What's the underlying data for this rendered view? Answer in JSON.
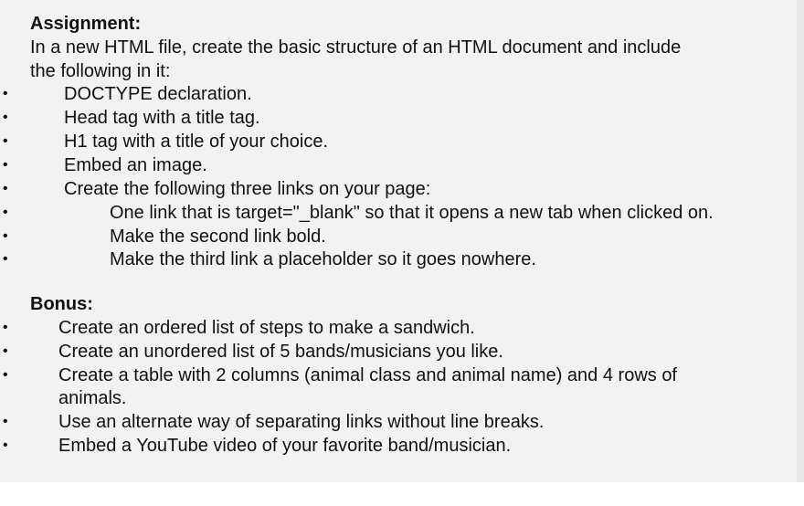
{
  "assignment": {
    "heading": "Assignment:",
    "intro_line1": "In a new HTML file, create the basic structure of an HTML document and include",
    "intro_line2": "the following in it:",
    "items": [
      "DOCTYPE declaration.",
      "Head tag with a title tag.",
      "H1 tag with a title of your choice.",
      "Embed an image.",
      "Create the following three links on your page:"
    ],
    "sub_items": [
      "One link that is target=\"_blank\" so that it opens a new tab when clicked on.",
      "Make the second link bold.",
      "Make the third link a placeholder so it goes nowhere."
    ]
  },
  "bonus": {
    "heading": "Bonus:",
    "items": [
      "Create an ordered list of steps to make a sandwich.",
      "Create an unordered list of 5 bands/musicians you like.",
      "Create a table with 2 columns (animal class and animal name) and 4 rows of",
      "Use an alternate way of separating links without line breaks.",
      "Embed a YouTube video of your favorite band/musician."
    ],
    "table_item_continuation": "animals."
  },
  "bullet_glyph": "•"
}
